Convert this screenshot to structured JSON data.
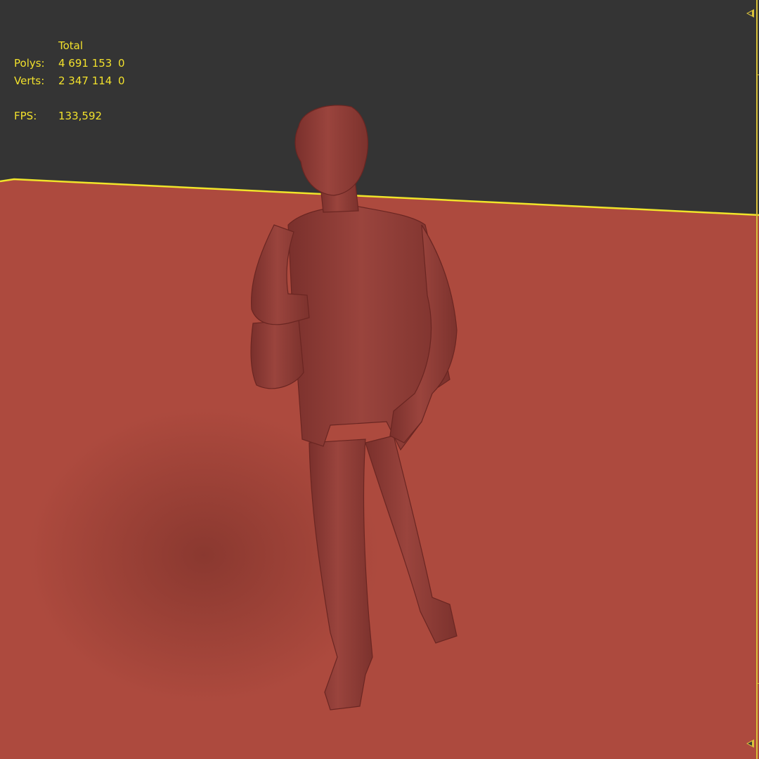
{
  "viewport": {
    "background_color": "#343434",
    "ground_color": "#ad4a3e",
    "model_color": "#8e3a35",
    "horizon_line_color": "#f0e42a",
    "overlay_text_color": "#f2e12c"
  },
  "stats": {
    "header": "Total",
    "rows": [
      {
        "label": "Polys:",
        "total": "4 691 153",
        "selected": "0"
      },
      {
        "label": "Verts:",
        "total": "2 347 114",
        "selected": "0"
      }
    ],
    "fps_label": "FPS:",
    "fps_value": "133,592"
  },
  "time_slider": {
    "line_color": "#d9c23a",
    "top_arrow_icon": "triangle-left-icon",
    "bottom_arrow_icon": "triangle-left-icon"
  }
}
